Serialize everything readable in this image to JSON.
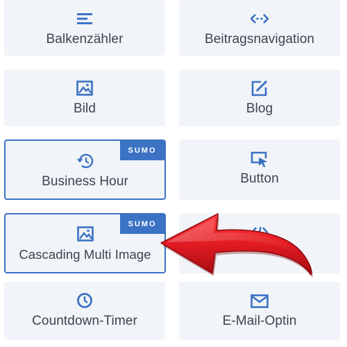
{
  "colors": {
    "accent": "#3b72c4",
    "tile_bg": "#f1f4f8",
    "text": "#3b4450",
    "arrow": "#d9141c"
  },
  "modules": [
    {
      "label": "Balkenzähler",
      "icon": "bars-icon",
      "badge": ""
    },
    {
      "label": "Beitragsnavigation",
      "icon": "code-arrows-icon",
      "badge": ""
    },
    {
      "label": "Bild",
      "icon": "image-icon",
      "badge": ""
    },
    {
      "label": "Blog",
      "icon": "edit-square-icon",
      "badge": ""
    },
    {
      "label": "Business Hour",
      "icon": "history-clock-icon",
      "badge": "SUMO"
    },
    {
      "label": "Button",
      "icon": "cursor-box-icon",
      "badge": ""
    },
    {
      "label": "Cascading Multi Image",
      "icon": "image-icon",
      "badge": "SUMO"
    },
    {
      "label": "",
      "icon": "code-icon",
      "badge": ""
    },
    {
      "label": "Countdown-Timer",
      "icon": "timer-icon",
      "badge": ""
    },
    {
      "label": "E-Mail-Optin",
      "icon": "envelope-icon",
      "badge": ""
    }
  ],
  "annotation": {
    "icon": "red-arrow-icon",
    "direction": "left"
  }
}
